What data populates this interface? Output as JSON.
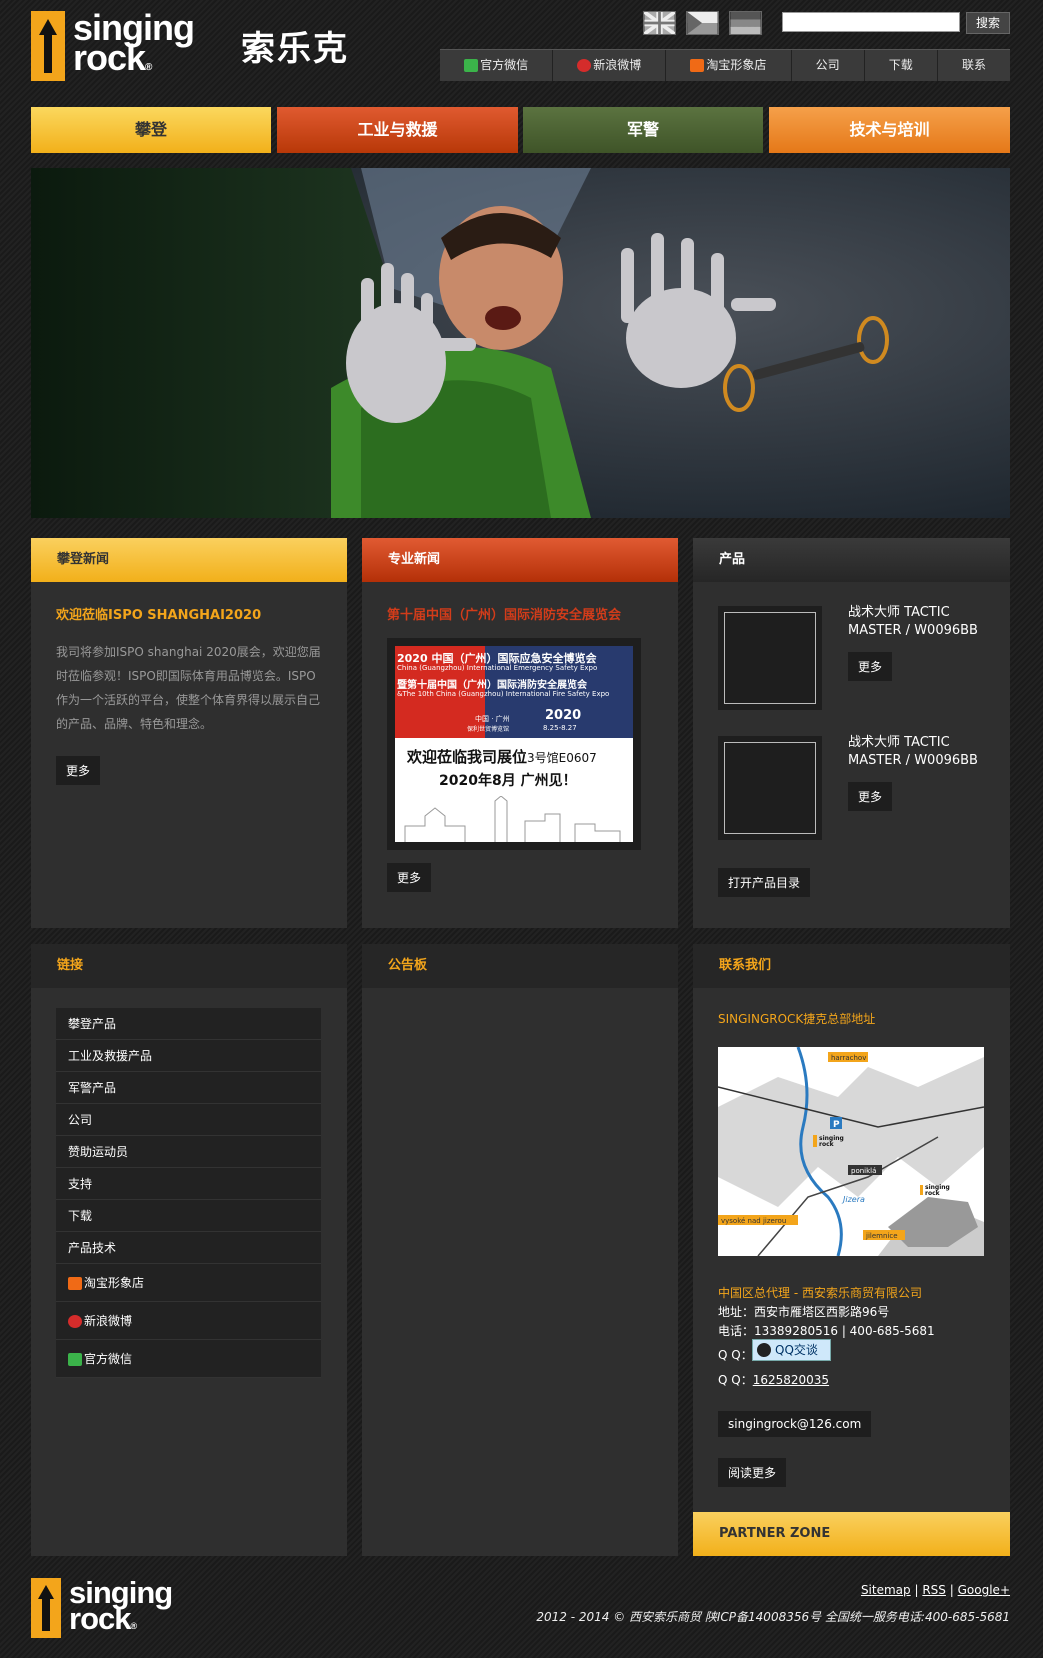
{
  "brand": {
    "word1": "singing",
    "word2": "rock",
    "cn": "索乐克",
    "reg": "®"
  },
  "header": {
    "search_btn": "搜索",
    "search_placeholder": "",
    "flags": [
      "english-flag",
      "czech-flag",
      "german-flag"
    ],
    "nav": [
      {
        "icon": "wechat-icon",
        "label": "官方微信"
      },
      {
        "icon": "weibo-icon",
        "label": "新浪微博"
      },
      {
        "icon": "taobao-icon",
        "label": "淘宝形象店"
      },
      {
        "label": "公司"
      },
      {
        "label": "下载"
      },
      {
        "label": "联系"
      }
    ]
  },
  "categories": [
    {
      "label": "攀登",
      "color": "#f2b01a"
    },
    {
      "label": "工业与救援",
      "color": "#c8421a"
    },
    {
      "label": "军警",
      "color": "#4f6434"
    },
    {
      "label": "技术与培训",
      "color": "#ee8a2a"
    }
  ],
  "news": {
    "title": "攀登新闻",
    "headline": "欢迎莅临ISPO SHANGHAI2020",
    "body": "我司将参加ISPO shanghai 2020展会，欢迎您届时莅临参观！ISPO即国际体育用品博览会。ISPO作为一个活跃的平台，使整个体育界得以展示自己的产品、品牌、特色和理念。",
    "more": "更多"
  },
  "pro": {
    "title": "专业新闻",
    "headline": "第十届中国（广州）国际消防安全展览会",
    "more": "更多",
    "poster": {
      "l1": "2020 中国（广州）国际应急安全博览会",
      "l2": "China (Guangzhou) International Emergency Safety Expo",
      "l3": "暨第十届中国（广州）国际消防安全展览会",
      "l4": "&The 10th China (Guangzhou) International Fire Safety Expo",
      "loc": "中国 · 广州",
      "venue": "保利世贸博览馆",
      "year": "2020",
      "dates": "8.25-8.27",
      "welcome": "欢迎莅临我司展位",
      "booth": "3号馆E0607",
      "when": "2020年8月  广州见！"
    }
  },
  "products": {
    "title": "产品",
    "items": [
      {
        "name": "战术大师 TACTIC MASTER / W0096BB",
        "more": "更多"
      },
      {
        "name": "战术大师 TACTIC MASTER / W0096BB",
        "more": "更多"
      }
    ],
    "catalog": "打开产品目录"
  },
  "links": {
    "title": "链接",
    "items": [
      {
        "label": "攀登产品"
      },
      {
        "label": "工业及救援产品"
      },
      {
        "label": "军警产品"
      },
      {
        "label": "公司"
      },
      {
        "label": "赞助运动员"
      },
      {
        "label": "支持"
      },
      {
        "label": "下载"
      },
      {
        "label": "产品技术"
      },
      {
        "label": "淘宝形象店",
        "icon": "taobao-icon"
      },
      {
        "label": "新浪微博",
        "icon": "weibo-icon"
      },
      {
        "label": "官方微信",
        "icon": "wechat-icon"
      }
    ]
  },
  "board": {
    "title": "公告板"
  },
  "contact": {
    "title": "联系我们",
    "hq": "SINGINGROCK捷克总部地址",
    "map": {
      "harrachov": "harrachov",
      "ponikla": "poniklá",
      "jizera": "Jizera",
      "vysoke": "vysoké nad jizerou",
      "jilemnice": "jilemnice",
      "brand1": "singing",
      "brand2": "rock"
    },
    "agent": "中国区总代理 - 西安索乐商贸有限公司",
    "addr_label": "地址：",
    "addr": "西安市雁塔区西影路96号",
    "tel_label": "电话：",
    "tel": "13389280516 | 400-685-5681",
    "qq_label": "Q Q：",
    "qq_btn": "QQ交谈",
    "qq2_label": "Q Q：",
    "qq2": "1625820035",
    "email": "singingrock@126.com",
    "more": "阅读更多",
    "partner": "PARTNER ZONE"
  },
  "footer": {
    "sitemap": "Sitemap",
    "rss": "RSS",
    "google": "Google+",
    "sep": "|",
    "copy": "2012 - 2014 © 西安索乐商贸 陕ICP备14008356号 全国统一服务电话:400-685-5681"
  }
}
